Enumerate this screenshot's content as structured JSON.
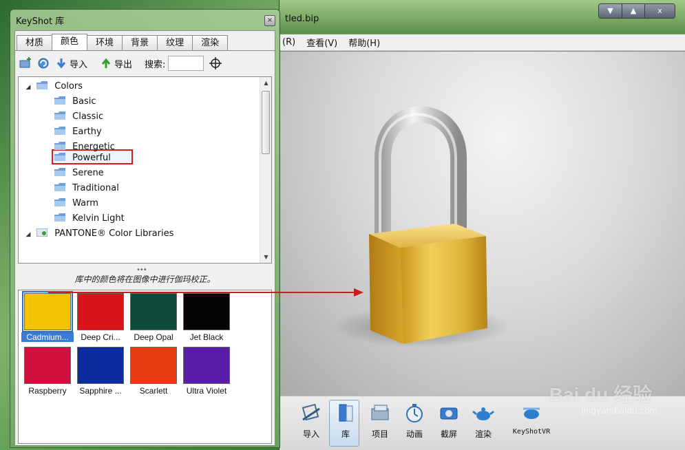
{
  "library_window": {
    "title": "KeyShot 库",
    "close_glyph": "×",
    "tabs": [
      {
        "label": "材质"
      },
      {
        "label": "颜色",
        "active": true
      },
      {
        "label": "环境"
      },
      {
        "label": "背景"
      },
      {
        "label": "纹理"
      },
      {
        "label": "渲染"
      }
    ],
    "toolbar": {
      "import_label": "导入",
      "export_label": "导出",
      "search_label": "搜索:",
      "search_value": ""
    },
    "tree": {
      "root": "Colors",
      "children": [
        "Basic",
        "Classic",
        "Earthy",
        "Energetic",
        "Powerful",
        "Serene",
        "Traditional",
        "Warm",
        "Kelvin Light"
      ],
      "selected": "Powerful",
      "next_root": "PANTONE® Color Libraries"
    },
    "note": "库中的颜色将在图像中进行伽玛校正。",
    "swatches": [
      {
        "name": "Cadmium...",
        "color": "#f5c400",
        "selected": true
      },
      {
        "name": "Deep Cri...",
        "color": "#d8141a"
      },
      {
        "name": "Deep Opal",
        "color": "#0f4a3a"
      },
      {
        "name": "Jet Black",
        "color": "#050505"
      },
      {
        "name": "Raspberry",
        "color": "#d0103f"
      },
      {
        "name": "Sapphire ...",
        "color": "#0a2c9c"
      },
      {
        "name": "Scarlett",
        "color": "#ea3c12"
      },
      {
        "name": "Ultra Violet",
        "color": "#5b1ba8"
      }
    ]
  },
  "main_window": {
    "title": "tled.bip",
    "window_controls": [
      "▼",
      "▲",
      "x"
    ],
    "menu": [
      "(R)",
      "查看(V)",
      "帮助(H)"
    ],
    "toolbar": [
      {
        "label": "导入",
        "icon": "import-icon"
      },
      {
        "label": "库",
        "icon": "library-icon",
        "active": true
      },
      {
        "label": "项目",
        "icon": "project-icon"
      },
      {
        "label": "动画",
        "icon": "animation-icon"
      },
      {
        "label": "截屏",
        "icon": "screenshot-icon"
      },
      {
        "label": "渲染",
        "icon": "render-icon"
      },
      {
        "label": "KeyShotVR",
        "icon": "keyshotvr-icon"
      }
    ]
  },
  "watermark": {
    "text": "Bai du 经验",
    "url": "jingyan.baidu.com"
  },
  "colors": {
    "annotation_red": "#c81e1e",
    "padlock_gold": "#e2b83a",
    "selection_blue": "#3a7bd5"
  }
}
